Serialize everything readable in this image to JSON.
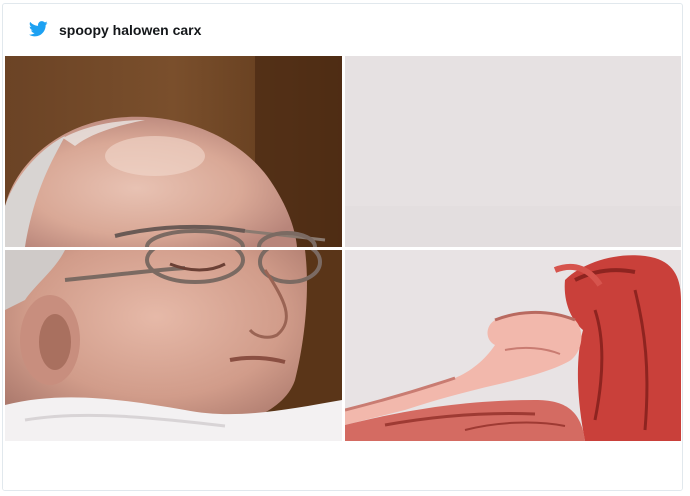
{
  "tweet": {
    "author_handle": "spoopy halowen carx",
    "brand_color": "#1da1f2",
    "icon": "twitter-bird-icon"
  },
  "media": {
    "layout": "2x2-split-image",
    "tiles": [
      {
        "position": "top-left",
        "depicts": "photo-face-top"
      },
      {
        "position": "top-right",
        "depicts": "anime-background-top"
      },
      {
        "position": "bottom-left",
        "depicts": "photo-face-bottom"
      },
      {
        "position": "bottom-right",
        "depicts": "anime-hand-and-hair"
      }
    ]
  }
}
